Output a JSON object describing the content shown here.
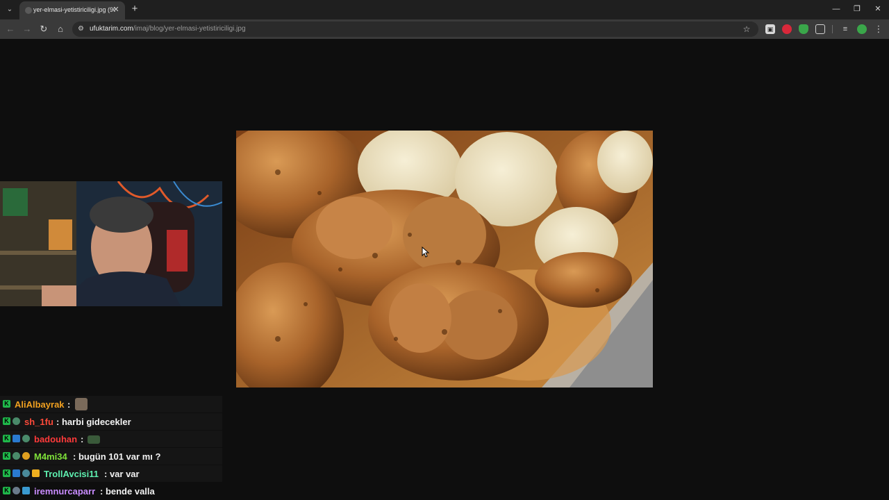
{
  "browser": {
    "tab_list_glyph": "⌄",
    "tab": {
      "title": "yer-elmasi-yetistiriciligi.jpg (900",
      "close_glyph": "✕"
    },
    "new_tab_glyph": "+",
    "window_controls": {
      "minimize": "—",
      "restore": "❐",
      "close": "✕"
    },
    "nav": {
      "back": "←",
      "forward": "→",
      "reload": "↻",
      "home": "⌂"
    },
    "omnibox": {
      "site_info_glyph": "⚙",
      "host": "ufuktarim.com",
      "path": "/imaj/blog/yer-elmasi-yetistiriciligi.jpg",
      "bookmark_glyph": "☆"
    },
    "menu_glyph": "⋮"
  },
  "viewer": {
    "image_alt": "yer-elmasi-yetistiriciligi.jpg",
    "accent_colors": {
      "page_bg": "#0e0e0e",
      "tuber": "#b8702e",
      "flesh": "#efe4c4",
      "board": "#c98a3e"
    }
  },
  "webcam": {
    "label": "streamer-webcam"
  },
  "chat": [
    {
      "user": "AliAlbayrak",
      "color": "#f0a020",
      "message": "",
      "emote": true
    },
    {
      "user": "sh_1fu",
      "color": "#ff4a3a",
      "message": ": harbi gidecekler",
      "emote": false
    },
    {
      "user": "badouhan",
      "color": "#ff3a3a",
      "message": ":",
      "emote": true
    },
    {
      "user": "M4mi34",
      "color": "#7fe23a",
      "message": ": bugün 101 var mı ?",
      "emote": false
    },
    {
      "user": "TrollAvcisi11",
      "color": "#5ef0b0",
      "message": ": var var",
      "emote": false
    },
    {
      "user": "iremnurcaparr",
      "color": "#c98cff",
      "message": ": bende valla",
      "emote": false
    }
  ],
  "chat_colon": ":"
}
